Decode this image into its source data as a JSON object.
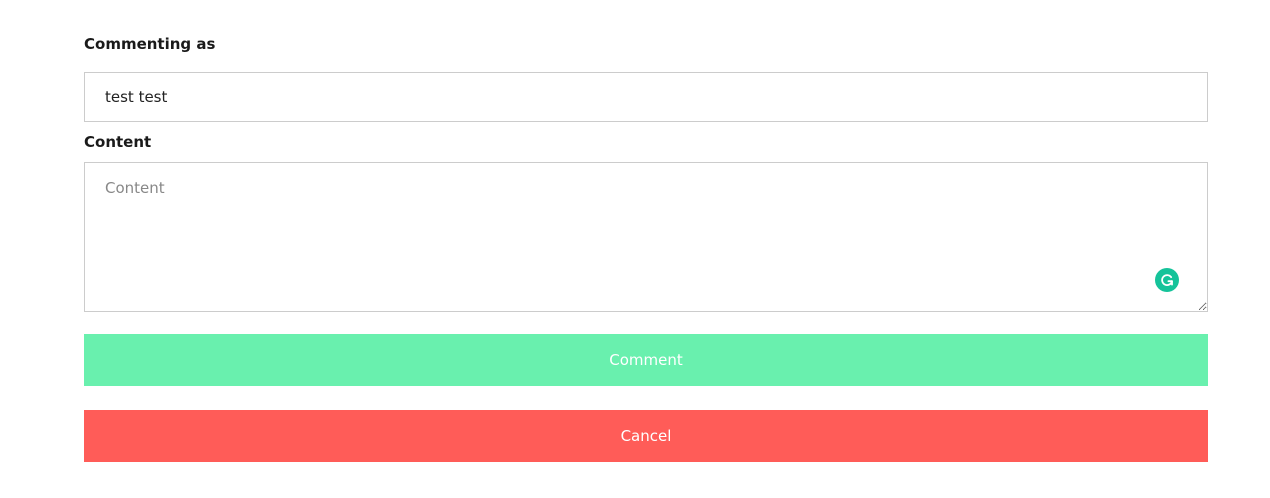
{
  "form": {
    "commenting_as_label": "Commenting as",
    "commenting_as_value": "test test",
    "content_label": "Content",
    "content_placeholder": "Content",
    "content_value": ""
  },
  "buttons": {
    "comment_label": "Comment",
    "cancel_label": "Cancel"
  },
  "icons": {
    "grammarly": "grammarly-icon"
  },
  "colors": {
    "comment_button": "#69f0ae",
    "cancel_button": "#ff5c58",
    "grammarly": "#15c39a"
  }
}
